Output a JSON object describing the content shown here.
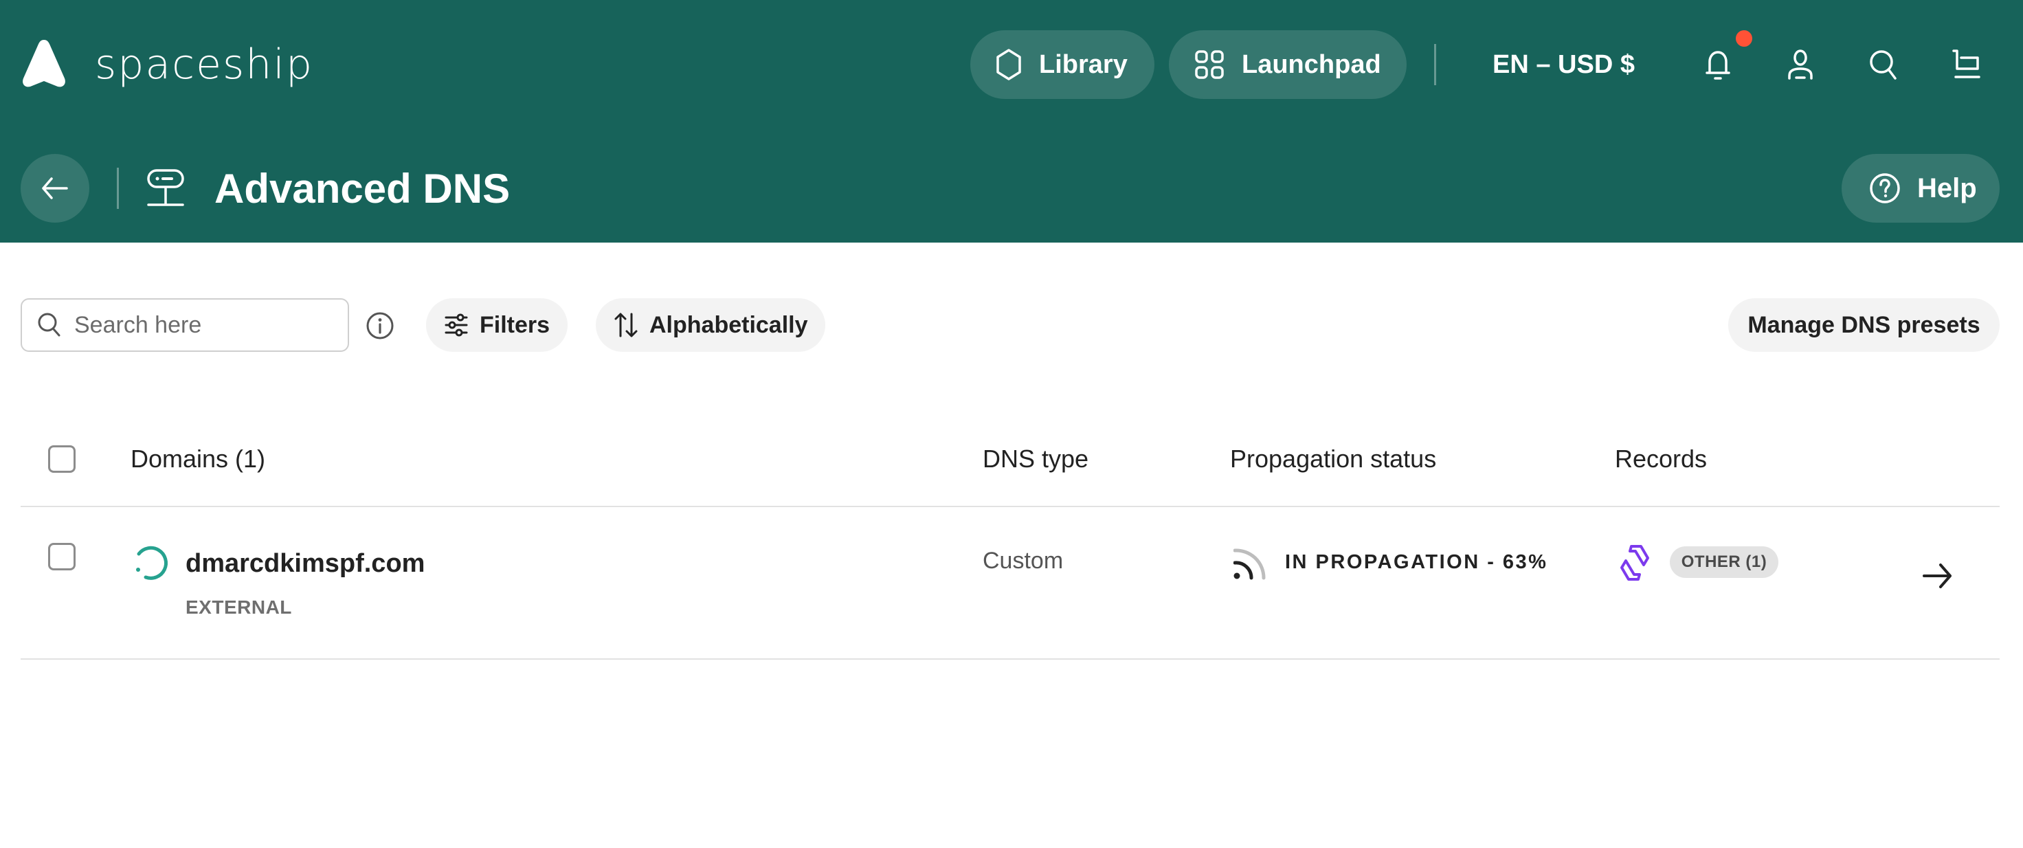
{
  "brand": {
    "name": "spaceship"
  },
  "nav": {
    "library_label": "Library",
    "launchpad_label": "Launchpad",
    "locale_label": "EN – USD $",
    "notifications_unread": true
  },
  "page": {
    "title": "Advanced DNS",
    "help_label": "Help"
  },
  "toolbar": {
    "search_placeholder": "Search here",
    "search_value": "",
    "filters_label": "Filters",
    "sort_label": "Alphabetically",
    "presets_label": "Manage DNS presets"
  },
  "table": {
    "columns": [
      "Domains (1)",
      "DNS type",
      "Propagation status",
      "Records"
    ],
    "rows": [
      {
        "domain": "dmarcdkimspf.com",
        "tag": "EXTERNAL",
        "dns_type": "Custom",
        "propagation_status": "IN PROPAGATION - 63%",
        "propagation_percent": 63,
        "records_badge": "OTHER (1)",
        "selected": false
      }
    ],
    "all_selected": false
  },
  "colors": {
    "header_bg": "#17635a",
    "accent_teal": "#26a28f",
    "notification": "#ff5236",
    "records_purple": "#7c3aed"
  }
}
